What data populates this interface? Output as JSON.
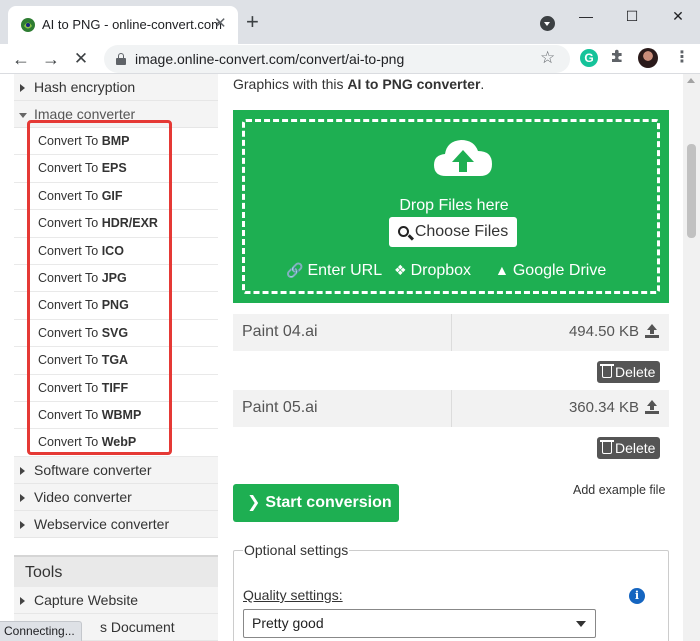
{
  "browser": {
    "tab_title": "AI to PNG - online-convert.com",
    "tab_close": "✕",
    "new_tab": "+",
    "url": "image.online-convert.com/convert/ai-to-png",
    "status": "Connecting...",
    "grammarly_letter": "G",
    "window_minimize": "—",
    "window_maximize": "☐",
    "window_close": "✕",
    "back": "←",
    "forward": "→",
    "stop": "✕",
    "star": "☆",
    "menu": "⋮"
  },
  "sidebar": {
    "hash_encryption": "Hash encryption",
    "image_converter": "Image converter",
    "convert_prefix": "Convert To ",
    "formats": [
      "BMP",
      "EPS",
      "GIF",
      "HDR/EXR",
      "ICO",
      "JPG",
      "PNG",
      "SVG",
      "TGA",
      "TIFF",
      "WBMP",
      "WebP"
    ],
    "software_converter": "Software converter",
    "video_converter": "Video converter",
    "webservice_converter": "Webservice converter",
    "tools_header": "Tools",
    "capture_website": "Capture Website",
    "partial_item": "s Document"
  },
  "main": {
    "intro_prefix": "Graphics with this ",
    "intro_bold": "AI to PNG converter",
    "intro_suffix": ".",
    "drop_text": "Drop Files here",
    "choose_files": "Choose Files",
    "enter_url": "Enter URL",
    "dropbox": "Dropbox",
    "google_drive": "Google Drive",
    "files": [
      {
        "name": "Paint 04.ai",
        "size": "494.50 KB"
      },
      {
        "name": "Paint 05.ai",
        "size": "360.34 KB"
      }
    ],
    "delete_label": "Delete",
    "start_conversion": "Start conversion",
    "add_example": "Add example file",
    "optional_settings": "Optional settings",
    "quality_label": "Quality settings:",
    "quality_value": "Pretty good"
  },
  "colors": {
    "green": "#1eaf52",
    "highlight_red": "#e53935",
    "info_blue": "#1565c0"
  }
}
